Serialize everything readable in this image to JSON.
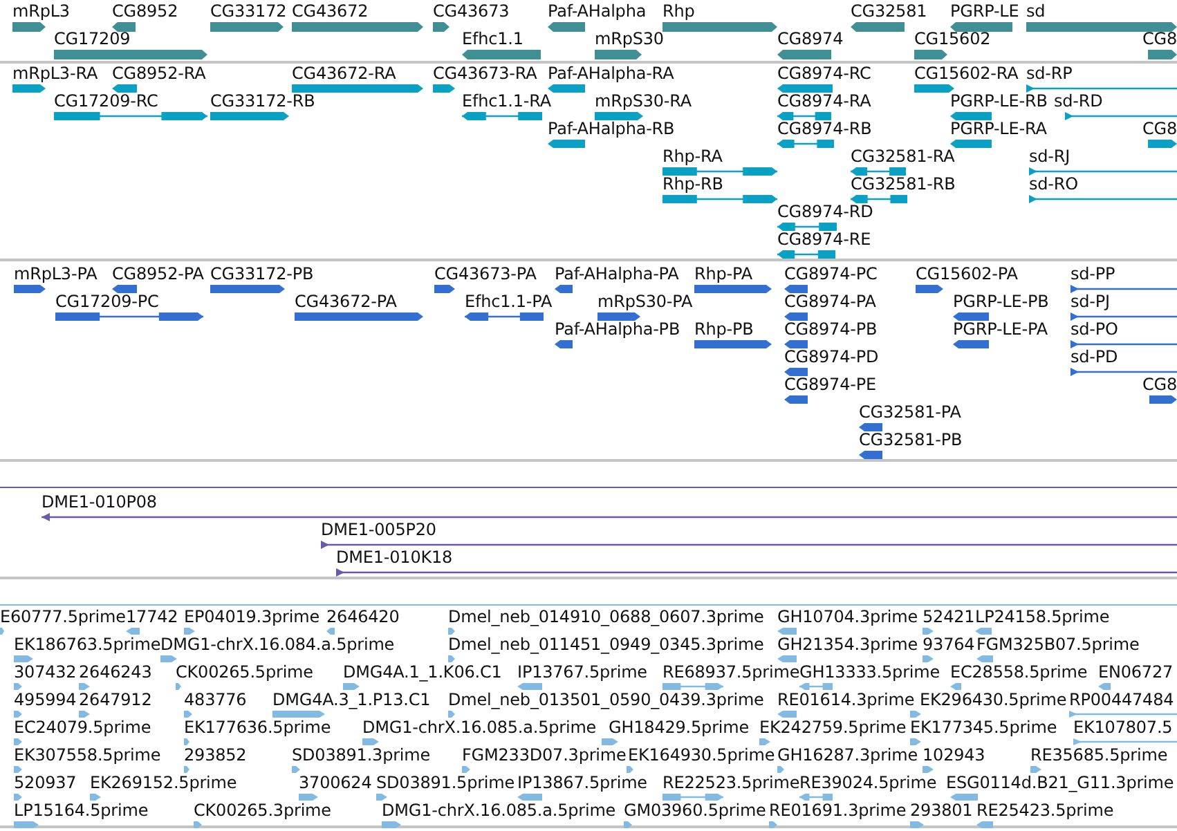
{
  "tracks": [
    {
      "kind": "gene",
      "features": [
        {
          "label": "mRpL3",
          "reverse": false
        },
        {
          "label": "CG8952",
          "reverse": true
        },
        {
          "label": "CG33172",
          "reverse": false
        },
        {
          "label": "CG43672",
          "reverse": false
        },
        {
          "label": "CG43673",
          "reverse": false
        },
        {
          "label": "Paf-AHalpha",
          "reverse": true
        },
        {
          "label": "Rhp",
          "reverse": false
        },
        {
          "label": "CG32581",
          "reverse": true
        },
        {
          "label": "PGRP-LE",
          "reverse": true
        },
        {
          "label": "sd",
          "reverse": false
        },
        {
          "label": "CG17209",
          "reverse": false
        },
        {
          "label": "Efhc1.1",
          "reverse": true
        },
        {
          "label": "mRpS30",
          "reverse": false
        },
        {
          "label": "CG8974",
          "reverse": true
        },
        {
          "label": "CG15602",
          "reverse": false
        },
        {
          "label": "CG8",
          "reverse": false
        }
      ]
    },
    {
      "kind": "transcript",
      "features": [
        {
          "label": "mRpL3-RA",
          "reverse": false
        },
        {
          "label": "CG8952-RA",
          "reverse": true
        },
        {
          "label": "CG43672-RA",
          "reverse": false
        },
        {
          "label": "CG43673-RA",
          "reverse": false
        },
        {
          "label": "Paf-AHalpha-RA",
          "reverse": true
        },
        {
          "label": "CG8974-RC",
          "reverse": true
        },
        {
          "label": "CG15602-RA",
          "reverse": false
        },
        {
          "label": "sd-RP",
          "reverse": false
        },
        {
          "label": "CG17209-RC",
          "reverse": false
        },
        {
          "label": "CG33172-RB",
          "reverse": false
        },
        {
          "label": "Efhc1.1-RA",
          "reverse": true
        },
        {
          "label": "mRpS30-RA",
          "reverse": false
        },
        {
          "label": "CG8974-RA",
          "reverse": true
        },
        {
          "label": "PGRP-LE-RB",
          "reverse": true
        },
        {
          "label": "sd-RD",
          "reverse": false
        },
        {
          "label": "Paf-AHalpha-RB",
          "reverse": true
        },
        {
          "label": "CG8974-RB",
          "reverse": true
        },
        {
          "label": "PGRP-LE-RA",
          "reverse": true
        },
        {
          "label": "CG8",
          "reverse": false
        },
        {
          "label": "Rhp-RA",
          "reverse": false
        },
        {
          "label": "CG32581-RA",
          "reverse": true
        },
        {
          "label": "sd-RJ",
          "reverse": false
        },
        {
          "label": "Rhp-RB",
          "reverse": false
        },
        {
          "label": "CG32581-RB",
          "reverse": true
        },
        {
          "label": "sd-RO",
          "reverse": false
        },
        {
          "label": "CG8974-RD",
          "reverse": true
        },
        {
          "label": "CG8974-RE",
          "reverse": true
        }
      ]
    },
    {
      "kind": "protein",
      "features": [
        {
          "label": "mRpL3-PA",
          "reverse": false
        },
        {
          "label": "CG8952-PA",
          "reverse": true
        },
        {
          "label": "CG33172-PB",
          "reverse": false
        },
        {
          "label": "CG43673-PA",
          "reverse": false
        },
        {
          "label": "Paf-AHalpha-PA",
          "reverse": true
        },
        {
          "label": "Rhp-PA",
          "reverse": false
        },
        {
          "label": "CG8974-PC",
          "reverse": true
        },
        {
          "label": "CG15602-PA",
          "reverse": false
        },
        {
          "label": "sd-PP",
          "reverse": false
        },
        {
          "label": "CG17209-PC",
          "reverse": false
        },
        {
          "label": "CG43672-PA",
          "reverse": false
        },
        {
          "label": "Efhc1.1-PA",
          "reverse": true
        },
        {
          "label": "mRpS30-PA",
          "reverse": false
        },
        {
          "label": "CG8974-PA",
          "reverse": true
        },
        {
          "label": "PGRP-LE-PB",
          "reverse": true
        },
        {
          "label": "sd-PJ",
          "reverse": false
        },
        {
          "label": "Paf-AHalpha-PB",
          "reverse": true
        },
        {
          "label": "Rhp-PB",
          "reverse": false
        },
        {
          "label": "CG8974-PB",
          "reverse": true
        },
        {
          "label": "PGRP-LE-PA",
          "reverse": true
        },
        {
          "label": "sd-PO",
          "reverse": false
        },
        {
          "label": "CG8974-PD",
          "reverse": true
        },
        {
          "label": "sd-PD",
          "reverse": false
        },
        {
          "label": "CG8974-PE",
          "reverse": true
        },
        {
          "label": "CG8",
          "reverse": false
        },
        {
          "label": "CG32581-PA",
          "reverse": true
        },
        {
          "label": "CG32581-PB",
          "reverse": true
        }
      ]
    },
    {
      "kind": "clone",
      "features": [
        {
          "label": "DME1-010P08",
          "reverse": true
        },
        {
          "label": "DME1-005P20",
          "reverse": false
        },
        {
          "label": "DME1-010K18",
          "reverse": false
        }
      ]
    },
    {
      "kind": "est",
      "features": [
        {
          "label": "E60777.5prime",
          "reverse": false
        },
        {
          "label": "17742",
          "reverse": true
        },
        {
          "label": "EP04019.3prime",
          "reverse": false
        },
        {
          "label": "2646420",
          "reverse": true
        },
        {
          "label": "Dmel_neb_014910_0688_0607.3prime",
          "reverse": false
        },
        {
          "label": "GH10704.3prime",
          "reverse": true
        },
        {
          "label": "52421",
          "reverse": false
        },
        {
          "label": "LP24158.5prime",
          "reverse": true
        },
        {
          "label": "EK186763.5prime",
          "reverse": false
        },
        {
          "label": "DMG1-chrX.16.084.a.5prime",
          "reverse": false
        },
        {
          "label": "Dmel_neb_011451_0949_0345.3prime",
          "reverse": false
        },
        {
          "label": "GH21354.3prime",
          "reverse": true
        },
        {
          "label": "93764",
          "reverse": false
        },
        {
          "label": "FGM325B07.5prime",
          "reverse": true
        },
        {
          "label": "307432",
          "reverse": false
        },
        {
          "label": "2646243",
          "reverse": false
        },
        {
          "label": "CK00265.5prime",
          "reverse": false
        },
        {
          "label": "DMG4A.1_1.K06.C1",
          "reverse": false
        },
        {
          "label": "IP13767.5prime",
          "reverse": true
        },
        {
          "label": "RE68937.5prime",
          "reverse": false
        },
        {
          "label": "GH13333.5prime",
          "reverse": true
        },
        {
          "label": "EC28558.5prime",
          "reverse": true
        },
        {
          "label": "EN06727",
          "reverse": true
        },
        {
          "label": "495994",
          "reverse": false
        },
        {
          "label": "2647912",
          "reverse": false
        },
        {
          "label": "483776",
          "reverse": false
        },
        {
          "label": "DMG4A.3_1.P13.C1",
          "reverse": false
        },
        {
          "label": "Dmel_neb_013501_0590_0439.3prime",
          "reverse": false
        },
        {
          "label": "RE01614.3prime",
          "reverse": true
        },
        {
          "label": "EK296430.5prime",
          "reverse": false
        },
        {
          "label": "RP00447484",
          "reverse": false
        },
        {
          "label": "EC24079.5prime",
          "reverse": false
        },
        {
          "label": "EK177636.5prime",
          "reverse": false
        },
        {
          "label": "DMG1-chrX.16.085.a.5prime",
          "reverse": false
        },
        {
          "label": "GH18429.5prime",
          "reverse": false
        },
        {
          "label": "EK242759.5prime",
          "reverse": false
        },
        {
          "label": "EK177345.5prime",
          "reverse": false
        },
        {
          "label": "EK107807.5",
          "reverse": false
        },
        {
          "label": "EK307558.5prime",
          "reverse": false
        },
        {
          "label": "293852",
          "reverse": false
        },
        {
          "label": "SD03891.3prime",
          "reverse": false
        },
        {
          "label": "FGM233D07.3prime",
          "reverse": false
        },
        {
          "label": "EK164930.5prime",
          "reverse": false
        },
        {
          "label": "GH16287.3prime",
          "reverse": false
        },
        {
          "label": "102943",
          "reverse": false
        },
        {
          "label": "RE35685.5prime",
          "reverse": false
        },
        {
          "label": "520937",
          "reverse": false
        },
        {
          "label": "EK269152.5prime",
          "reverse": false
        },
        {
          "label": "3700624",
          "reverse": false
        },
        {
          "label": "SD03891.5prime",
          "reverse": false
        },
        {
          "label": "IP13867.5prime",
          "reverse": true
        },
        {
          "label": "RE22523.5prime",
          "reverse": false
        },
        {
          "label": "RE39024.5prime",
          "reverse": true
        },
        {
          "label": "ESG0114d.B21_G11.3prime",
          "reverse": true
        },
        {
          "label": "LP15164.5prime",
          "reverse": false
        },
        {
          "label": "CK00265.3prime",
          "reverse": false
        },
        {
          "label": "DMG1-chrX.16.085.a.5prime",
          "reverse": false
        },
        {
          "label": "GM03960.5prime",
          "reverse": false
        },
        {
          "label": "RE01691.3prime",
          "reverse": false
        },
        {
          "label": "293801",
          "reverse": false
        },
        {
          "label": "RE25423.5prime",
          "reverse": true
        }
      ]
    }
  ]
}
